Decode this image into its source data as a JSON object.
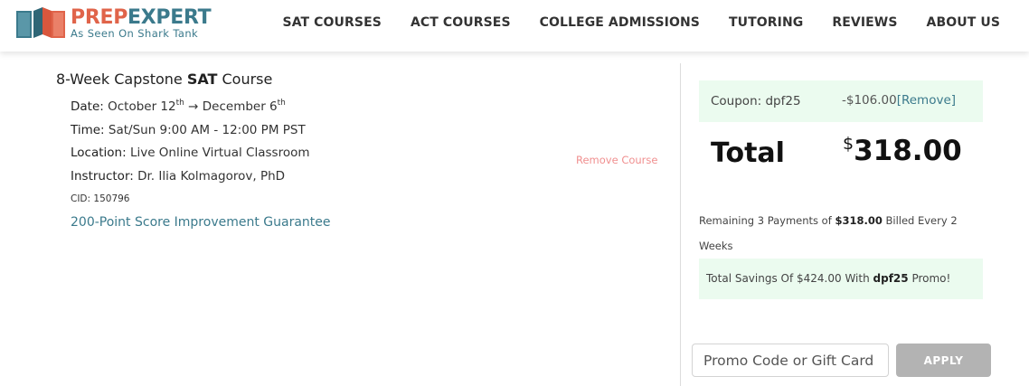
{
  "brand": {
    "name_part1": "PREP",
    "name_part2": "EXPERT",
    "tagline": "As Seen On Shark Tank",
    "colors": {
      "accent_orange": "#e0644a",
      "accent_teal": "#3b7a8c"
    }
  },
  "nav": {
    "items": [
      {
        "label": "SAT COURSES"
      },
      {
        "label": "ACT COURSES"
      },
      {
        "label": "COLLEGE ADMISSIONS"
      },
      {
        "label": "TUTORING"
      },
      {
        "label": "REVIEWS"
      },
      {
        "label": "ABOUT US"
      }
    ]
  },
  "course": {
    "title_prefix": "8-Week Capstone ",
    "title_bold": "SAT",
    "title_suffix": " Course",
    "date_label": "Date:",
    "date_start": " October 12",
    "date_start_sup": "th",
    "date_arrow": " → ",
    "date_end": "December 6",
    "date_end_sup": "th",
    "time_label": "Time:",
    "time_value": " Sat/Sun 9:00 AM - 12:00 PM PST",
    "location_label": "Location:",
    "location_value": " Live Online Virtual Classroom",
    "instructor_label": "Instructor:",
    "instructor_value": " Dr. Ilia Kolmagorov, PhD",
    "cid_label": "CID:",
    "cid_value": " 150796",
    "guarantee_link": "200-Point Score Improvement Guarantee",
    "remove_label": "Remove Course"
  },
  "summary": {
    "coupon_label": "Coupon: dpf25",
    "coupon_amount": "-$106.00",
    "coupon_remove": "[Remove]",
    "total_label": "Total",
    "total_currency": "$",
    "total_amount": "318.00",
    "payments_prefix": "Remaining 3 Payments of ",
    "payments_amount": "$318.00",
    "payments_suffix": " Billed Every 2 Weeks",
    "savings_prefix": "Total Savings Of $424.00 With ",
    "savings_code": "dpf25",
    "savings_suffix": " Promo!",
    "promo_placeholder": "Promo Code or Gift Card",
    "apply_label": "APPLY"
  }
}
